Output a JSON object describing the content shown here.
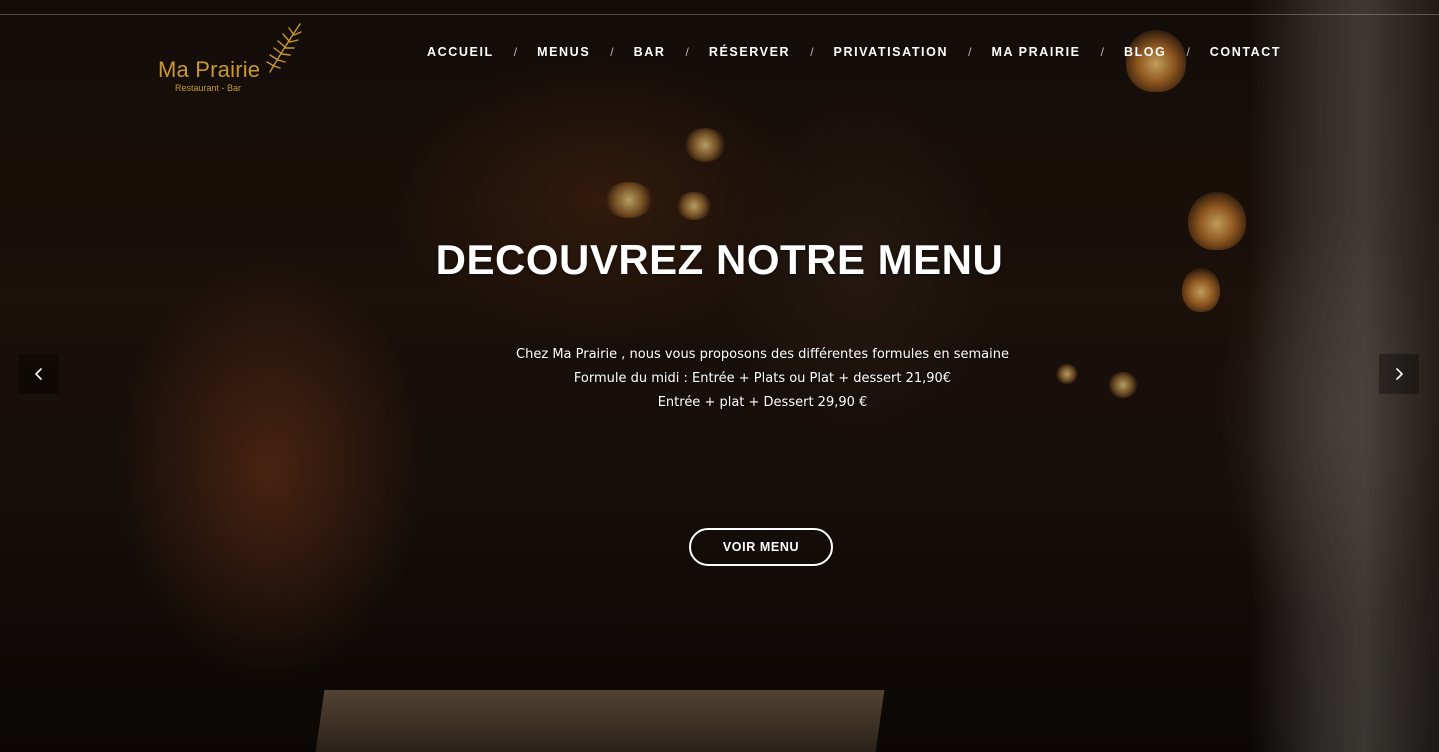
{
  "brand": {
    "name": "Ma Prairie",
    "tagline": "Restaurant - Bar",
    "color": "#c9982f",
    "icon": "fern-leaf-icon"
  },
  "nav": {
    "items": [
      {
        "label": "ACCUEIL"
      },
      {
        "label": "MENUS"
      },
      {
        "label": "BAR"
      },
      {
        "label": "RÉSERVER"
      },
      {
        "label": "PRIVATISATION"
      },
      {
        "label": "MA PRAIRIE"
      },
      {
        "label": "BLOG"
      },
      {
        "label": "CONTACT"
      }
    ],
    "separator": "/"
  },
  "hero": {
    "title": "DECOUVREZ NOTRE MENU",
    "lines": [
      "Chez Ma Prairie , nous vous proposons des différentes formules en semaine",
      "Formule du midi : Entrée + Plats ou Plat + dessert 21,90€",
      "Entrée + plat + Dessert 29,90 €"
    ],
    "cta_label": "VOIR MENU",
    "prev_icon": "chevron-left-icon",
    "next_icon": "chevron-right-icon"
  }
}
